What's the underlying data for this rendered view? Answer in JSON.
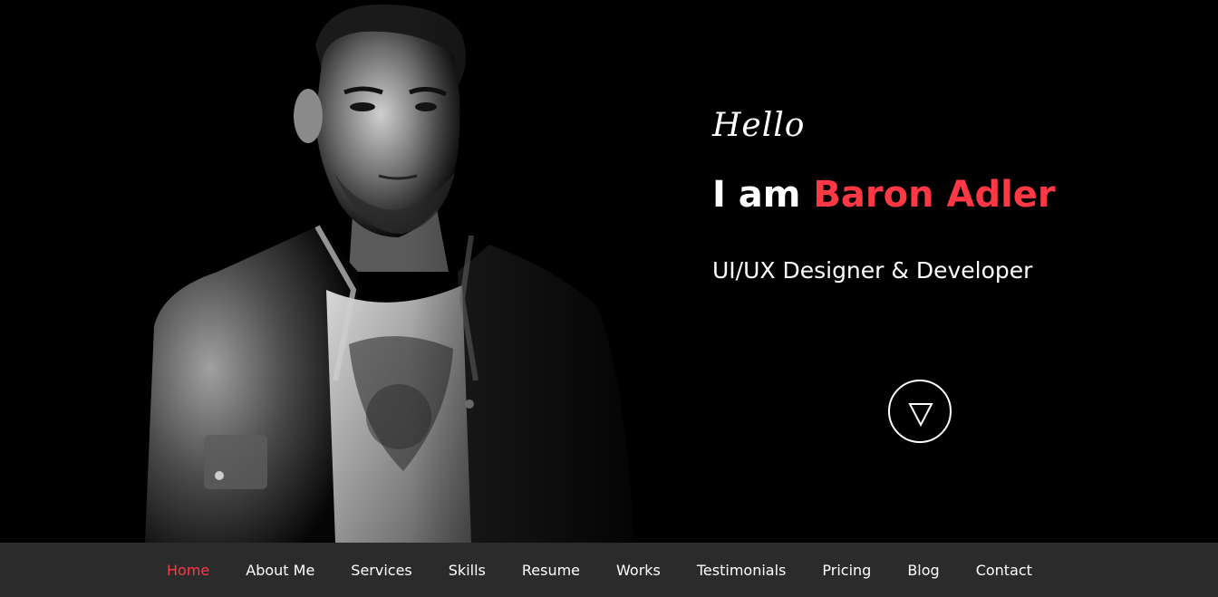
{
  "hero": {
    "greeting": "Hello",
    "intro_prefix": "I am ",
    "name": "Baron Adler",
    "role": "UI/UX Designer & Developer",
    "accent_color": "#ff3845"
  },
  "scroll_button": {
    "icon": "triangle-down-icon"
  },
  "nav": {
    "items": [
      {
        "label": "Home",
        "active": true
      },
      {
        "label": "About Me"
      },
      {
        "label": "Services"
      },
      {
        "label": "Skills"
      },
      {
        "label": "Resume"
      },
      {
        "label": "Works"
      },
      {
        "label": "Testimonials"
      },
      {
        "label": "Pricing"
      },
      {
        "label": "Blog"
      },
      {
        "label": "Contact"
      }
    ]
  }
}
